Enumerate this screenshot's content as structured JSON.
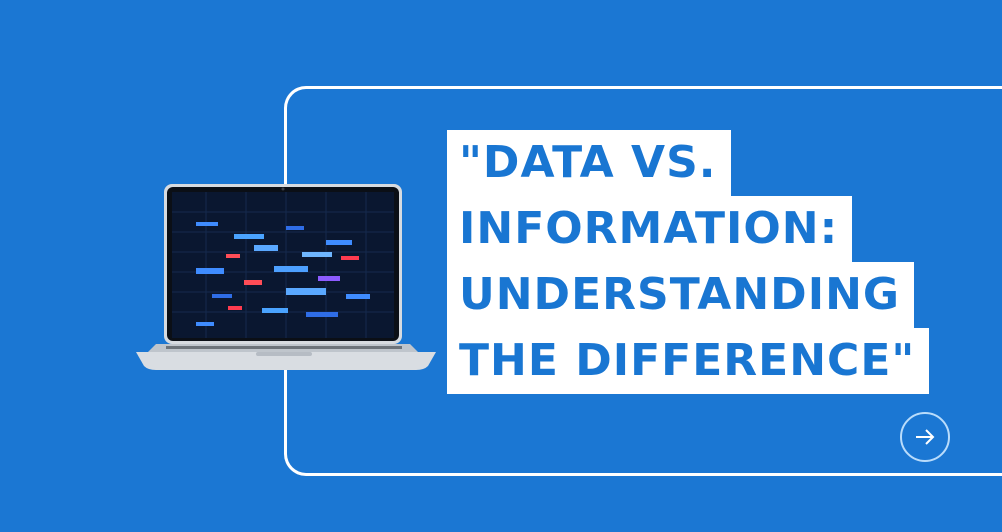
{
  "background_color": "#1b77d3",
  "accent_color": "#1976d2",
  "title_lines": [
    "\"DATA VS.",
    "INFORMATION:",
    "UNDERSTANDING",
    "THE DIFFERENCE\""
  ],
  "icons": {
    "next": "arrow-right-circle-icon",
    "device": "laptop-icon"
  }
}
